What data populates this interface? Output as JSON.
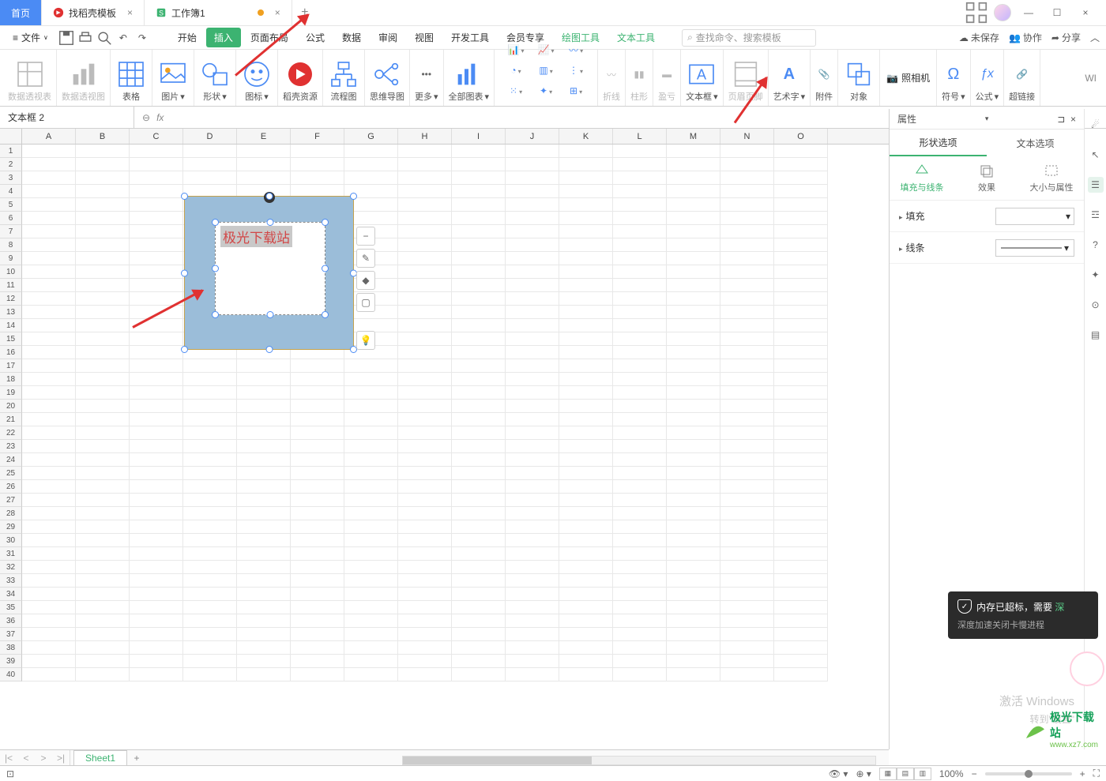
{
  "tabs": {
    "home": "首页",
    "tpl": "找稻壳模板",
    "doc": "工作簿1"
  },
  "file_menu": "文件",
  "menus": {
    "start": "开始",
    "insert": "插入",
    "layout": "页面布局",
    "formula": "公式",
    "data": "数据",
    "review": "审阅",
    "view": "视图",
    "dev": "开发工具",
    "vip": "会员专享",
    "draw": "绘图工具",
    "text": "文本工具"
  },
  "search_placeholder": "查找命令、搜索模板",
  "right_actions": {
    "unsaved": "未保存",
    "collab": "协作",
    "share": "分享"
  },
  "ribbon": {
    "pivot_table": "数据透视表",
    "pivot_chart": "数据透视图",
    "table": "表格",
    "picture": "图片",
    "shape": "形状",
    "icon": "图标",
    "docer": "稻壳资源",
    "flowchart": "流程图",
    "mindmap": "思维导图",
    "more": "更多",
    "allcharts": "全部图表",
    "line": "折线",
    "bar": "柱形",
    "winloss": "盈亏",
    "textbox": "文本框",
    "headerfooter": "页眉页脚",
    "wordart": "艺术字",
    "attach": "附件",
    "object": "对象",
    "camera": "照相机",
    "symbol": "符号",
    "equation": "公式",
    "hyperlink": "超链接"
  },
  "namebox": "文本框  2",
  "columns": [
    "A",
    "B",
    "C",
    "D",
    "E",
    "F",
    "G",
    "H",
    "I",
    "J",
    "K",
    "L",
    "M",
    "N",
    "O"
  ],
  "rows": [
    "1",
    "2",
    "3",
    "4",
    "5",
    "6",
    "7",
    "8",
    "9",
    "10",
    "11",
    "12",
    "13",
    "14",
    "15",
    "16",
    "17",
    "18",
    "19",
    "20",
    "21",
    "22",
    "23",
    "24",
    "25",
    "26",
    "27",
    "28",
    "29",
    "30",
    "31",
    "32",
    "33",
    "34",
    "35",
    "36",
    "37",
    "38",
    "39",
    "40"
  ],
  "shape_text": "极光下载站",
  "props": {
    "title": "属性",
    "tab_shape": "形状选项",
    "tab_text": "文本选项",
    "sub_fill": "填充与线条",
    "sub_effect": "效果",
    "sub_size": "大小与属性",
    "fill": "填充",
    "line": "线条"
  },
  "sheet_tab": "Sheet1",
  "status": {
    "zoom": "100%"
  },
  "toast": {
    "title": "内存已超标，需要",
    "sub": "深度加速关闭卡慢进程"
  },
  "watermark": {
    "l1": "激活 Windows",
    "l2": "转到\"设置\""
  },
  "logo": {
    "name": "极光下载站",
    "url": "www.xz7.com"
  }
}
